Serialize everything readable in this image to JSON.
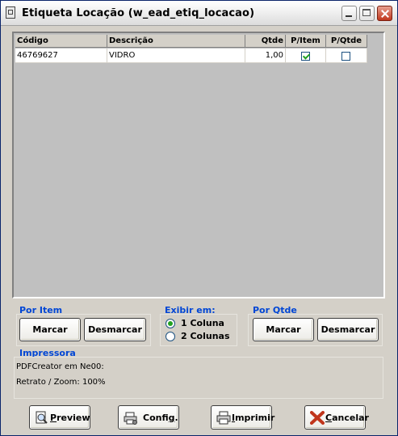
{
  "window": {
    "title": "Etiqueta Locação (w_ead_etiq_locacao)"
  },
  "grid": {
    "columns": [
      "Código",
      "Descrição",
      "Qtde",
      "P/Item",
      "P/Qtde"
    ],
    "rows": [
      {
        "codigo": "46769627",
        "descricao": "VIDRO",
        "qtde": "1,00",
        "p_item": true,
        "p_qtde": false
      }
    ]
  },
  "por_item": {
    "label": "Por Item",
    "marcar": "Marcar",
    "desmarcar": "Desmarcar"
  },
  "exibir_em": {
    "label": "Exibir em:",
    "options": [
      "1 Coluna",
      "2 Colunas"
    ],
    "selected": "1 Coluna"
  },
  "por_qtde": {
    "label": "Por Qtde",
    "marcar": "Marcar",
    "desmarcar": "Desmarcar"
  },
  "impressora": {
    "label": "Impressora",
    "printer": "PDFCreator em Ne00:",
    "layout": "Retrato / Zoom: 100%"
  },
  "footer": {
    "preview": {
      "underline": "P",
      "rest": "review"
    },
    "config": {
      "prefix": "Confi",
      "underline": "g",
      "rest": "."
    },
    "imprimir": {
      "underline": "I",
      "rest": "mprimir"
    },
    "cancelar": {
      "underline": "C",
      "rest": "ancelar"
    }
  },
  "colors": {
    "accent_blue": "#0046d5",
    "check_green": "#21a121",
    "close_red": "#c0361c"
  }
}
